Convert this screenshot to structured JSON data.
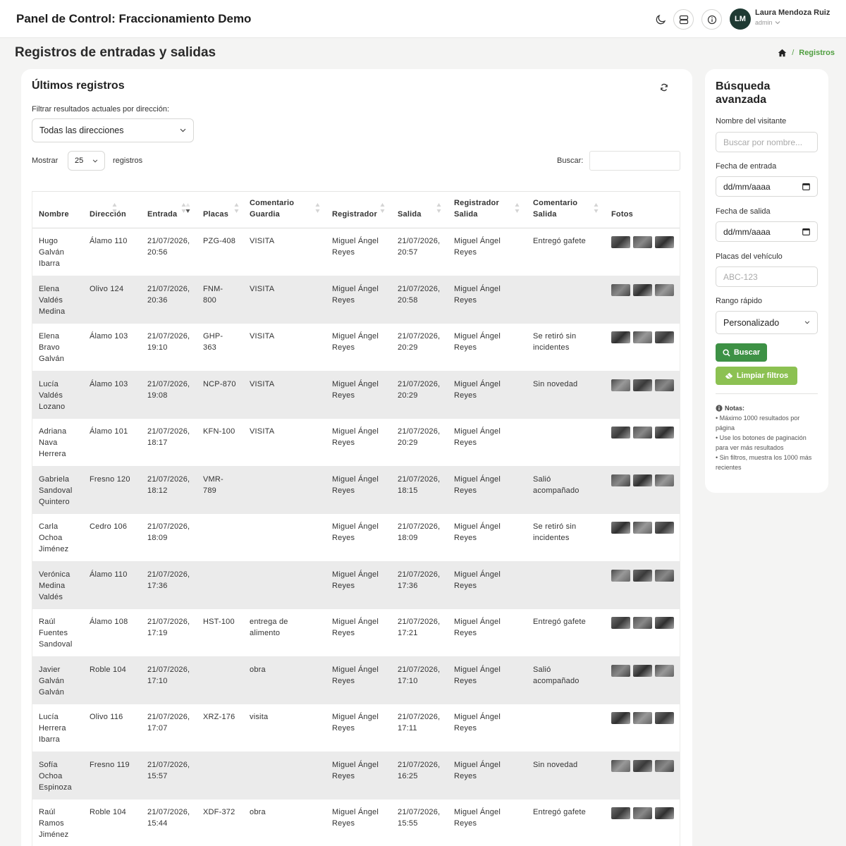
{
  "header": {
    "app_title": "Panel de Control: Fraccionamiento Demo",
    "user": {
      "initials": "LM",
      "name": "Laura Mendoza Ruiz",
      "role": "admin"
    },
    "icons": [
      "moon-icon",
      "server-icon",
      "info-icon",
      "chevron-down-icon"
    ]
  },
  "page": {
    "title": "Registros de entradas y salidas",
    "breadcrumb": {
      "sep": "/",
      "current": "Registros"
    }
  },
  "main": {
    "title": "Últimos registros",
    "filter_label": "Filtrar resultados actuales por dirección:",
    "filter_value": "Todas las direcciones",
    "show_label": "Mostrar",
    "page_length": "25",
    "records_label": "registros",
    "search_label": "Buscar:",
    "search_value": "",
    "columns": [
      {
        "l1": "Nombre",
        "l2": ""
      },
      {
        "l1": "Dirección",
        "l2": ""
      },
      {
        "l1": "Entrada",
        "l2": ""
      },
      {
        "l1": "Placas",
        "l2": ""
      },
      {
        "l1": "Comentario",
        "l2": "Guardia"
      },
      {
        "l1": "Registrador",
        "l2": ""
      },
      {
        "l1": "Salida",
        "l2": ""
      },
      {
        "l1": "Registrador",
        "l2": "Salida"
      },
      {
        "l1": "Comentario",
        "l2": "Salida"
      },
      {
        "l1": "Fotos",
        "l2": ""
      }
    ],
    "rows": [
      {
        "nombre": [
          "Hugo",
          "Galván",
          "Ibarra"
        ],
        "direccion": "Álamo 110",
        "entrada": [
          "21/07/2026,",
          "20:56"
        ],
        "placas": [
          "PZG-408"
        ],
        "comentario": [
          "VISITA"
        ],
        "registrador": [
          "Miguel Ángel",
          "Reyes"
        ],
        "salida": [
          "21/07/2026,",
          "20:57"
        ],
        "reg_salida": [
          "Miguel Ángel",
          "Reyes"
        ],
        "com_salida": [
          "Entregó gafete"
        ]
      },
      {
        "nombre": [
          "Elena",
          "Valdés",
          "Medina"
        ],
        "direccion": "Olivo 124",
        "entrada": [
          "21/07/2026,",
          "20:36"
        ],
        "placas": [
          "FNM-",
          "800"
        ],
        "comentario": [
          "VISITA"
        ],
        "registrador": [
          "Miguel Ángel",
          "Reyes"
        ],
        "salida": [
          "21/07/2026,",
          "20:58"
        ],
        "reg_salida": [
          "Miguel Ángel",
          "Reyes"
        ],
        "com_salida": []
      },
      {
        "nombre": [
          "Elena",
          "Bravo",
          "Galván"
        ],
        "direccion": "Álamo 103",
        "entrada": [
          "21/07/2026,",
          "19:10"
        ],
        "placas": [
          "GHP-",
          "363"
        ],
        "comentario": [
          "VISITA"
        ],
        "registrador": [
          "Miguel Ángel",
          "Reyes"
        ],
        "salida": [
          "21/07/2026,",
          "20:29"
        ],
        "reg_salida": [
          "Miguel Ángel",
          "Reyes"
        ],
        "com_salida": [
          "Se retiró sin",
          "incidentes"
        ]
      },
      {
        "nombre": [
          "Lucía",
          "Valdés",
          "Lozano"
        ],
        "direccion": "Álamo 103",
        "entrada": [
          "21/07/2026,",
          "19:08"
        ],
        "placas": [
          "NCP-870"
        ],
        "comentario": [
          "VISITA"
        ],
        "registrador": [
          "Miguel Ángel",
          "Reyes"
        ],
        "salida": [
          "21/07/2026,",
          "20:29"
        ],
        "reg_salida": [
          "Miguel Ángel",
          "Reyes"
        ],
        "com_salida": [
          "Sin novedad"
        ]
      },
      {
        "nombre": [
          "Adriana",
          "Nava",
          "Herrera"
        ],
        "direccion": "Álamo 101",
        "entrada": [
          "21/07/2026,",
          "18:17"
        ],
        "placas": [
          "KFN-100"
        ],
        "comentario": [
          "VISITA"
        ],
        "registrador": [
          "Miguel Ángel",
          "Reyes"
        ],
        "salida": [
          "21/07/2026,",
          "20:29"
        ],
        "reg_salida": [
          "Miguel Ángel",
          "Reyes"
        ],
        "com_salida": []
      },
      {
        "nombre": [
          "Gabriela",
          "Sandoval",
          "Quintero"
        ],
        "direccion": "Fresno 120",
        "entrada": [
          "21/07/2026,",
          "18:12"
        ],
        "placas": [
          "VMR-",
          "789"
        ],
        "comentario": [],
        "registrador": [
          "Miguel Ángel",
          "Reyes"
        ],
        "salida": [
          "21/07/2026,",
          "18:15"
        ],
        "reg_salida": [
          "Miguel Ángel",
          "Reyes"
        ],
        "com_salida": [
          "Salió",
          "acompañado"
        ]
      },
      {
        "nombre": [
          "Carla",
          "Ochoa",
          "Jiménez"
        ],
        "direccion": "Cedro 106",
        "entrada": [
          "21/07/2026,",
          "18:09"
        ],
        "placas": [],
        "comentario": [],
        "registrador": [
          "Miguel Ángel",
          "Reyes"
        ],
        "salida": [
          "21/07/2026,",
          "18:09"
        ],
        "reg_salida": [
          "Miguel Ángel",
          "Reyes"
        ],
        "com_salida": [
          "Se retiró sin",
          "incidentes"
        ]
      },
      {
        "nombre": [
          "Verónica",
          "Medina",
          "Valdés"
        ],
        "direccion": "Álamo 110",
        "entrada": [
          "21/07/2026,",
          "17:36"
        ],
        "placas": [],
        "comentario": [],
        "registrador": [
          "Miguel Ángel",
          "Reyes"
        ],
        "salida": [
          "21/07/2026,",
          "17:36"
        ],
        "reg_salida": [
          "Miguel Ángel",
          "Reyes"
        ],
        "com_salida": []
      },
      {
        "nombre": [
          "Raúl",
          "Fuentes",
          "Sandoval"
        ],
        "direccion": "Álamo 108",
        "entrada": [
          "21/07/2026,",
          "17:19"
        ],
        "placas": [
          "HST-100"
        ],
        "comentario": [
          "entrega de",
          "alimento"
        ],
        "registrador": [
          "Miguel Ángel",
          "Reyes"
        ],
        "salida": [
          "21/07/2026,",
          "17:21"
        ],
        "reg_salida": [
          "Miguel Ángel",
          "Reyes"
        ],
        "com_salida": [
          "Entregó gafete"
        ]
      },
      {
        "nombre": [
          "Javier",
          "Galván",
          "Galván"
        ],
        "direccion": "Roble 104",
        "entrada": [
          "21/07/2026,",
          "17:10"
        ],
        "placas": [],
        "comentario": [
          "obra"
        ],
        "registrador": [
          "Miguel Ángel",
          "Reyes"
        ],
        "salida": [
          "21/07/2026,",
          "17:10"
        ],
        "reg_salida": [
          "Miguel Ángel",
          "Reyes"
        ],
        "com_salida": [
          "Salió",
          "acompañado"
        ]
      },
      {
        "nombre": [
          "Lucía",
          "Herrera",
          "Ibarra"
        ],
        "direccion": "Olivo 116",
        "entrada": [
          "21/07/2026,",
          "17:07"
        ],
        "placas": [
          "XRZ-176"
        ],
        "comentario": [
          "visita"
        ],
        "registrador": [
          "Miguel Ángel",
          "Reyes"
        ],
        "salida": [
          "21/07/2026,",
          "17:11"
        ],
        "reg_salida": [
          "Miguel Ángel",
          "Reyes"
        ],
        "com_salida": []
      },
      {
        "nombre": [
          "Sofía",
          "Ochoa",
          "Espinoza"
        ],
        "direccion": "Fresno 119",
        "entrada": [
          "21/07/2026,",
          "15:57"
        ],
        "placas": [],
        "comentario": [],
        "registrador": [
          "Miguel Ángel",
          "Reyes"
        ],
        "salida": [
          "21/07/2026,",
          "16:25"
        ],
        "reg_salida": [
          "Miguel Ángel",
          "Reyes"
        ],
        "com_salida": [
          "Sin novedad"
        ]
      },
      {
        "nombre": [
          "Raúl",
          "Ramos",
          "Jiménez"
        ],
        "direccion": "Roble 104",
        "entrada": [
          "21/07/2026,",
          "15:44"
        ],
        "placas": [
          "XDF-372"
        ],
        "comentario": [
          "obra"
        ],
        "registrador": [
          "Miguel Ángel",
          "Reyes"
        ],
        "salida": [
          "21/07/2026,",
          "15:55"
        ],
        "reg_salida": [
          "Miguel Ángel",
          "Reyes"
        ],
        "com_salida": [
          "Entregó gafete"
        ]
      }
    ]
  },
  "sidebar": {
    "title": "Búsqueda avanzada",
    "name_label": "Nombre del visitante",
    "name_placeholder": "Buscar por nombre...",
    "entry_label": "Fecha de entrada",
    "entry_placeholder": "dd/mm/aaaa",
    "exit_label": "Fecha de salida",
    "exit_placeholder": "dd/mm/aaaa",
    "plates_label": "Placas del vehículo",
    "plates_placeholder": "ABC-123",
    "range_label": "Rango rápido",
    "range_value": "Personalizado",
    "search_button": "Buscar",
    "clear_button": "Limpiar filtros",
    "notes_title": "Notas:",
    "notes": [
      "• Máximo 1000 resultados por página",
      "• Use los botones de paginación para ver más resultados",
      "• Sin filtros, muestra los 1000 más recientes"
    ]
  },
  "colors": {
    "primary": "#3d9145",
    "secondary": "#8cc152",
    "avatar": "#1f3a33",
    "row_alt": "#ebebeb"
  }
}
